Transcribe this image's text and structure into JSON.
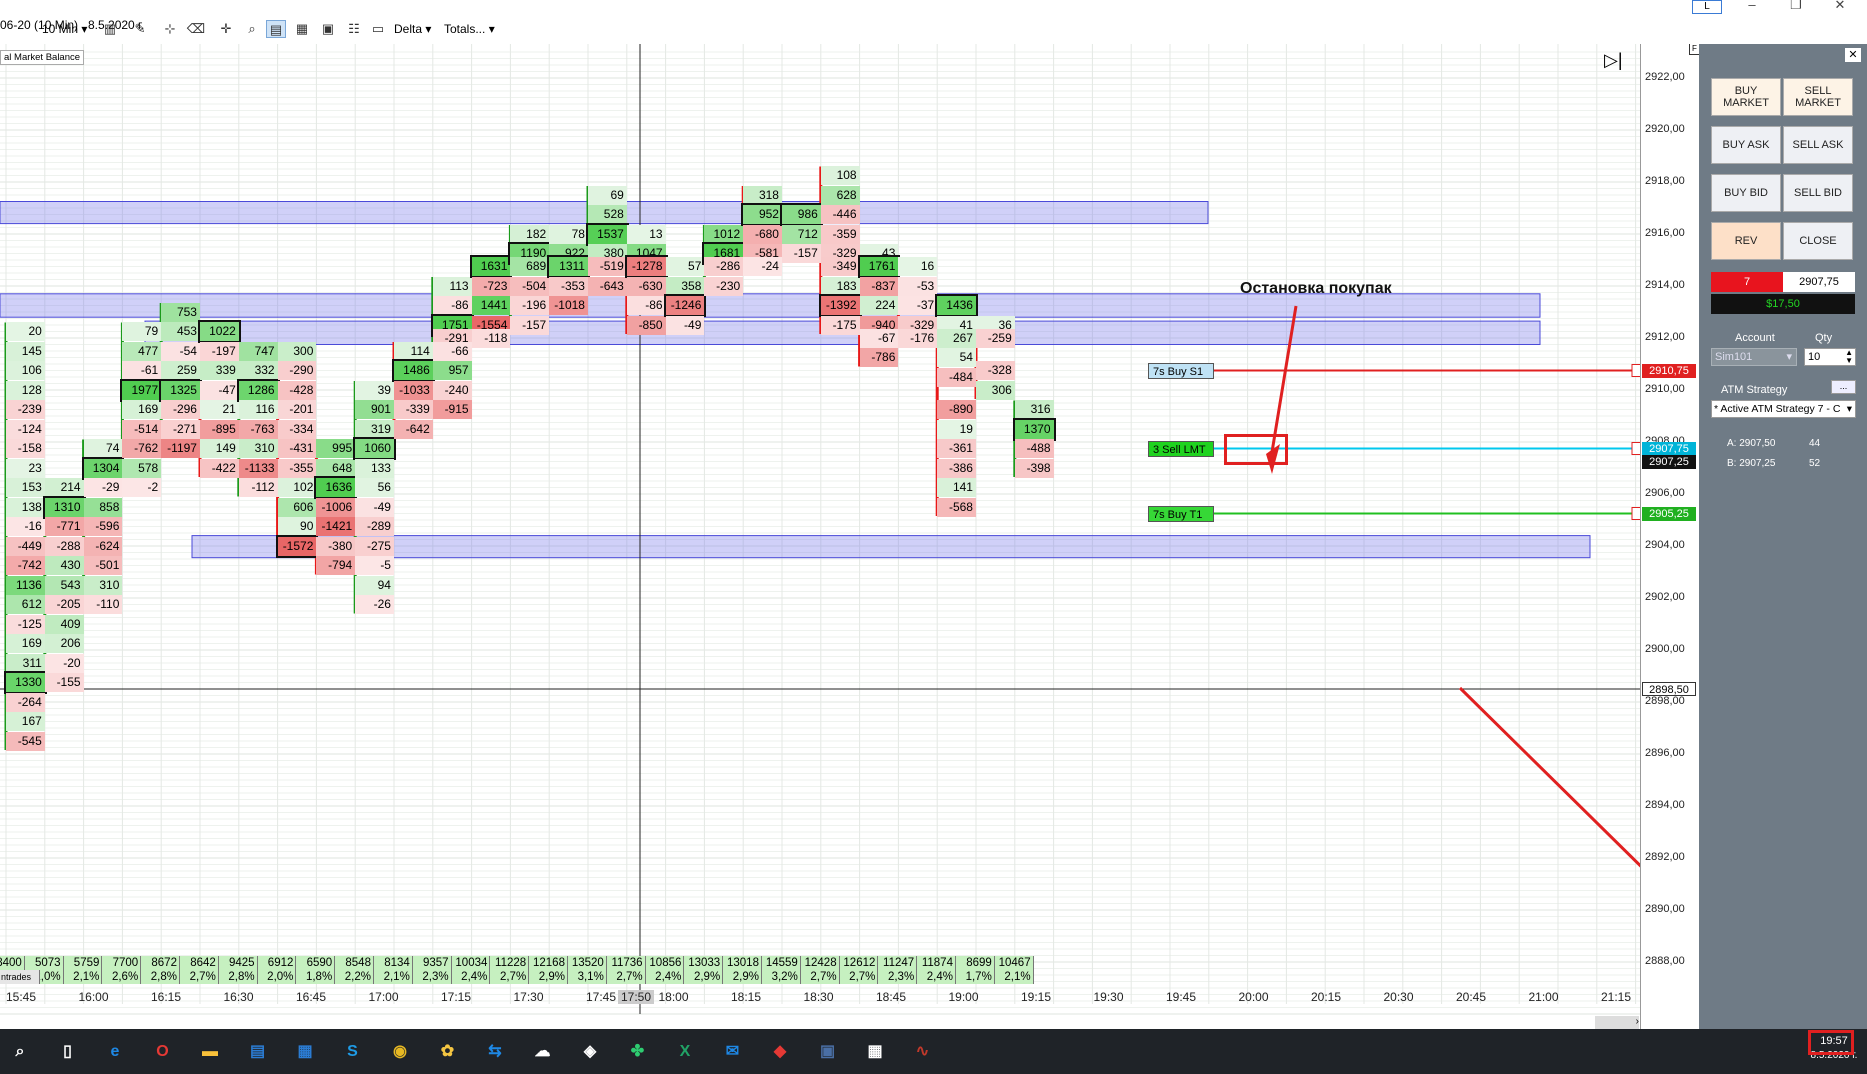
{
  "toolbar": {
    "instrument": "06-20 (10 Min)",
    "date": "8.5.2020 г.",
    "timeframe": "10 Min",
    "delta_label": "Delta",
    "totals_label": "Totals...",
    "right_badge": "L"
  },
  "chart": {
    "indicator_label": "al Market Balance",
    "annotation": "Остановка покупак",
    "crosshair_time": "17:50",
    "trades_label": "ntrades",
    "price_ticks": [
      {
        "label": "2922,00",
        "price": 2922
      },
      {
        "label": "2920,00",
        "price": 2920
      },
      {
        "label": "2918,00",
        "price": 2918
      },
      {
        "label": "2916,00",
        "price": 2916
      },
      {
        "label": "2914,00",
        "price": 2914
      },
      {
        "label": "2912,00",
        "price": 2912
      },
      {
        "label": "2910,00",
        "price": 2910
      },
      {
        "label": "2908,00",
        "price": 2908
      },
      {
        "label": "2906,00",
        "price": 2906
      },
      {
        "label": "2904,00",
        "price": 2904
      },
      {
        "label": "2902,00",
        "price": 2902
      },
      {
        "label": "2900,00",
        "price": 2900
      },
      {
        "label": "2898,00",
        "price": 2898
      },
      {
        "label": "2896,00",
        "price": 2896
      },
      {
        "label": "2894,00",
        "price": 2894
      },
      {
        "label": "2892,00",
        "price": 2892
      },
      {
        "label": "2890,00",
        "price": 2890
      },
      {
        "label": "2888,00",
        "price": 2888
      }
    ],
    "price_tags": [
      {
        "label": "2910,75",
        "price": 2910.75,
        "color": "#e02020"
      },
      {
        "label": "2907,75",
        "price": 2907.75,
        "color": "#00b4d8"
      },
      {
        "label": "2907,25",
        "price": 2907.25,
        "color": "#111111"
      },
      {
        "label": "2905,25",
        "price": 2905.25,
        "color": "#20b020"
      },
      {
        "label": "2898,50",
        "price": 2898.5,
        "color": "#ffffff"
      }
    ],
    "time_labels": [
      "15:45",
      "16:00",
      "16:15",
      "16:30",
      "16:45",
      "17:00",
      "17:15",
      "17:30",
      "17:45",
      "18:00",
      "18:15",
      "18:30",
      "18:45",
      "19:00",
      "19:15",
      "19:30",
      "19:45",
      "20:00",
      "20:15",
      "20:30",
      "20:45",
      "21:00",
      "21:15"
    ],
    "volumes": [
      "8400",
      "5073",
      "5759",
      "7700",
      "8672",
      "8642",
      "9425",
      "6912",
      "6590",
      "8548",
      "8134",
      "9357",
      "10034",
      "11228",
      "12168",
      "13520",
      "11736",
      "10856",
      "13033",
      "13018",
      "14559",
      "12428",
      "12612",
      "11247",
      "11874",
      "8699",
      "10467"
    ],
    "deltas": [
      "",
      "2,0%",
      "2,1%",
      "2,6%",
      "2,8%",
      "2,7%",
      "2,8%",
      "2,0%",
      "1,8%",
      "2,2%",
      "2,1%",
      "2,3%",
      "2,4%",
      "2,7%",
      "2,9%",
      "3,1%",
      "2,7%",
      "2,4%",
      "2,9%",
      "2,9%",
      "3,2%",
      "2,7%",
      "2,7%",
      "2,3%",
      "2,4%",
      "1,7%",
      "2,1%"
    ],
    "orders": [
      {
        "label": "7s  Buy S1",
        "price": 2910.75
      },
      {
        "label": "3  Sell LMT",
        "price": 2907.75
      },
      {
        "label": "7s  Buy T1",
        "price": 2905.25
      }
    ],
    "bars": [
      {
        "cells": [
          [
            2912.25,
            "20"
          ],
          [
            2911.5,
            "145"
          ],
          [
            2910.75,
            "106"
          ],
          [
            2910,
            "128"
          ],
          [
            2909.25,
            "-239"
          ],
          [
            2908.5,
            "-124"
          ],
          [
            2907.75,
            "-158"
          ],
          [
            2907,
            "23"
          ],
          [
            2906.25,
            "153"
          ],
          [
            2905.5,
            "138"
          ],
          [
            2904.75,
            "-16"
          ],
          [
            2904,
            "-449"
          ],
          [
            2903.25,
            "-742"
          ],
          [
            2902.5,
            "1136"
          ],
          [
            2901.75,
            "612"
          ],
          [
            2901,
            "-125"
          ],
          [
            2900.25,
            "169"
          ],
          [
            2899.5,
            "311"
          ],
          [
            2898.75,
            "1330"
          ],
          [
            2898,
            "-264"
          ],
          [
            2897.25,
            "167"
          ],
          [
            2896.5,
            "-545"
          ]
        ]
      },
      {
        "cells": [
          [
            2906.25,
            "214"
          ],
          [
            2905.5,
            "1310"
          ],
          [
            2904.75,
            "-771"
          ],
          [
            2904,
            "-288"
          ],
          [
            2903.25,
            "430"
          ],
          [
            2902.5,
            "543"
          ],
          [
            2901.75,
            "-205"
          ],
          [
            2901,
            "409"
          ],
          [
            2900.25,
            "206"
          ],
          [
            2899.5,
            "-20"
          ],
          [
            2898.75,
            "-155"
          ]
        ]
      },
      {
        "cells": [
          [
            2907.75,
            "74"
          ],
          [
            2907,
            "1304"
          ],
          [
            2906.25,
            "-29"
          ],
          [
            2905.5,
            "858"
          ],
          [
            2904.75,
            "-596"
          ],
          [
            2904,
            "-624"
          ],
          [
            2903.25,
            "-501"
          ],
          [
            2902.5,
            "310"
          ],
          [
            2901.75,
            "-110"
          ]
        ]
      },
      {
        "cells": [
          [
            2912.25,
            "79"
          ],
          [
            2911.5,
            "477"
          ],
          [
            2910.75,
            "-61"
          ],
          [
            2910,
            "1977"
          ],
          [
            2909.25,
            "169"
          ],
          [
            2908.5,
            "-514"
          ],
          [
            2907.75,
            "-762"
          ],
          [
            2907,
            "578"
          ],
          [
            2906.25,
            "-2"
          ]
        ]
      },
      {
        "cells": [
          [
            2913,
            "753"
          ],
          [
            2912.25,
            "453"
          ],
          [
            2911.5,
            "-54"
          ],
          [
            2910.75,
            "259"
          ],
          [
            2910,
            "1325"
          ],
          [
            2909.25,
            "-296"
          ],
          [
            2908.5,
            "-271"
          ],
          [
            2907.75,
            "-1197"
          ]
        ]
      },
      {
        "cells": [
          [
            2912.25,
            "1022"
          ],
          [
            2911.5,
            "-197"
          ],
          [
            2910.75,
            "339"
          ],
          [
            2910,
            "-47"
          ],
          [
            2909.25,
            "21"
          ],
          [
            2908.5,
            "-895"
          ],
          [
            2907.75,
            "149"
          ],
          [
            2907,
            "-422"
          ]
        ]
      },
      {
        "cells": [
          [
            2911.5,
            "747"
          ],
          [
            2910.75,
            "332"
          ],
          [
            2910,
            "1286"
          ],
          [
            2909.25,
            "116"
          ],
          [
            2908.5,
            "-763"
          ],
          [
            2907.75,
            "310"
          ],
          [
            2907,
            "-1133"
          ],
          [
            2906.25,
            "-112"
          ]
        ]
      },
      {
        "cells": [
          [
            2911.5,
            "300"
          ],
          [
            2910.75,
            "-290"
          ],
          [
            2910,
            "-428"
          ],
          [
            2909.25,
            "-201"
          ],
          [
            2908.5,
            "-334"
          ],
          [
            2907.75,
            "-431"
          ],
          [
            2907,
            "-355"
          ],
          [
            2906.25,
            "102"
          ],
          [
            2905.5,
            "606"
          ],
          [
            2904.75,
            "90"
          ],
          [
            2904,
            "-1572"
          ]
        ]
      },
      {
        "cells": [
          [
            2907.75,
            "995"
          ],
          [
            2907,
            "648"
          ],
          [
            2906.25,
            "1636"
          ],
          [
            2905.5,
            "-1006"
          ],
          [
            2904.75,
            "-1421"
          ],
          [
            2904,
            "-380"
          ],
          [
            2903.25,
            "-794"
          ]
        ]
      },
      {
        "cells": [
          [
            2910,
            "39"
          ],
          [
            2909.25,
            "901"
          ],
          [
            2908.5,
            "319"
          ],
          [
            2907.75,
            "1060"
          ],
          [
            2907,
            "133"
          ],
          [
            2906.25,
            "56"
          ],
          [
            2905.5,
            "-49"
          ],
          [
            2904.75,
            "-289"
          ],
          [
            2904,
            "-275"
          ],
          [
            2903.25,
            "-5"
          ],
          [
            2902.5,
            "94"
          ],
          [
            2901.75,
            "-26"
          ]
        ]
      },
      {
        "cells": [
          [
            2911.5,
            "114"
          ],
          [
            2910.75,
            "1486"
          ],
          [
            2910,
            "-1033"
          ],
          [
            2909.25,
            "-339"
          ],
          [
            2908.5,
            "-642"
          ]
        ]
      },
      {
        "cells": [
          [
            2914,
            "113"
          ],
          [
            2913.25,
            "-86"
          ],
          [
            2912.5,
            "1751"
          ],
          [
            2912,
            "-291"
          ],
          [
            2911.5,
            "-66"
          ],
          [
            2910.75,
            "957"
          ],
          [
            2910,
            "-240"
          ],
          [
            2909.25,
            "-915"
          ]
        ]
      },
      {
        "cells": [
          [
            2914.75,
            "1631"
          ],
          [
            2914,
            "-723"
          ],
          [
            2913.25,
            "1441"
          ],
          [
            2912.5,
            "-1554"
          ],
          [
            2912,
            "-118"
          ]
        ]
      },
      {
        "cells": [
          [
            2916,
            "182"
          ],
          [
            2915.25,
            "1190"
          ],
          [
            2914.75,
            "689"
          ],
          [
            2914,
            "-504"
          ],
          [
            2913.25,
            "-196"
          ],
          [
            2912.5,
            "-157"
          ]
        ]
      },
      {
        "cells": [
          [
            2916,
            "78"
          ],
          [
            2915.25,
            "922"
          ],
          [
            2914.75,
            "1311"
          ],
          [
            2914,
            "-353"
          ],
          [
            2913.25,
            "-1018"
          ]
        ]
      },
      {
        "cells": [
          [
            2917.5,
            "69"
          ],
          [
            2916.75,
            "528"
          ],
          [
            2916,
            "1537"
          ],
          [
            2915.25,
            "380"
          ],
          [
            2914.75,
            "-519"
          ],
          [
            2914,
            "-643"
          ]
        ]
      },
      {
        "cells": [
          [
            2916,
            "13"
          ],
          [
            2915.25,
            "1047"
          ],
          [
            2914.75,
            "-1278"
          ],
          [
            2914,
            "-630"
          ],
          [
            2913.25,
            "-86"
          ],
          [
            2912.5,
            "-850"
          ]
        ]
      },
      {
        "cells": [
          [
            2914.75,
            "57"
          ],
          [
            2914,
            "358"
          ],
          [
            2913.25,
            "-1246"
          ],
          [
            2912.5,
            "-49"
          ]
        ]
      },
      {
        "cells": [
          [
            2916,
            "1012"
          ],
          [
            2915.25,
            "1681"
          ],
          [
            2914.75,
            "-286"
          ],
          [
            2914,
            "-230"
          ]
        ]
      },
      {
        "cells": [
          [
            2917.5,
            "318"
          ],
          [
            2916.75,
            "952"
          ],
          [
            2916,
            "-680"
          ],
          [
            2915.25,
            "-581"
          ],
          [
            2914.75,
            "-24"
          ]
        ]
      },
      {
        "cells": [
          [
            2916.75,
            "986"
          ],
          [
            2916,
            "712"
          ],
          [
            2915.25,
            "-157"
          ]
        ]
      },
      {
        "cells": [
          [
            2918.25,
            "108"
          ],
          [
            2917.5,
            "628"
          ],
          [
            2916.75,
            "-446"
          ],
          [
            2916,
            "-359"
          ],
          [
            2915.25,
            "-329"
          ],
          [
            2914.75,
            "-349"
          ],
          [
            2914,
            "183"
          ],
          [
            2913.25,
            "-1392"
          ],
          [
            2912.5,
            "-175"
          ]
        ]
      },
      {
        "cells": [
          [
            2915.25,
            "43"
          ],
          [
            2914.75,
            "1761"
          ],
          [
            2914,
            "-837"
          ],
          [
            2913.25,
            "224"
          ],
          [
            2912.5,
            "-940"
          ],
          [
            2912,
            "-67"
          ],
          [
            2911.25,
            "-786"
          ]
        ]
      },
      {
        "cells": [
          [
            2914.75,
            "16"
          ],
          [
            2914,
            "-53"
          ],
          [
            2913.25,
            "-37"
          ],
          [
            2912.5,
            "-329"
          ],
          [
            2912,
            "-176"
          ]
        ]
      },
      {
        "cells": [
          [
            2913.25,
            "1436"
          ],
          [
            2912.5,
            "41"
          ],
          [
            2912,
            "267"
          ],
          [
            2911.25,
            "54"
          ],
          [
            2910.5,
            "-484"
          ],
          [
            2909.25,
            "-890"
          ],
          [
            2908.5,
            "19"
          ],
          [
            2907.75,
            "-361"
          ],
          [
            2907,
            "-386"
          ],
          [
            2906.25,
            "141"
          ],
          [
            2905.5,
            "-568"
          ]
        ]
      },
      {
        "cells": [
          [
            2912.5,
            "36"
          ],
          [
            2912,
            "-259"
          ],
          [
            2910.75,
            "-328"
          ],
          [
            2910,
            "306"
          ]
        ]
      },
      {
        "cells": [
          [
            2909.25,
            "316"
          ],
          [
            2908.5,
            "1370"
          ],
          [
            2907.75,
            "-488"
          ],
          [
            2907,
            "-398"
          ]
        ]
      }
    ],
    "zones": [
      {
        "top": 2917.25,
        "bottom": 2916.4
      },
      {
        "top": 2913.7,
        "bottom": 2912.8
      },
      {
        "top": 2912.65,
        "bottom": 2911.75
      },
      {
        "top": 2904.4,
        "bottom": 2903.55
      }
    ]
  },
  "panel": {
    "buy_market": "BUY MARKET",
    "sell_market": "SELL MARKET",
    "buy_ask": "BUY ASK",
    "sell_ask": "SELL ASK",
    "buy_bid": "BUY BID",
    "sell_bid": "SELL BID",
    "rev": "REV",
    "close": "CLOSE",
    "position_qty": "7",
    "position_price": "2907,75",
    "pnl": "$17,50",
    "account_label": "Account",
    "qty_label": "Qty",
    "account_value": "Sim101",
    "qty_value": "10",
    "atm_label": "ATM Strategy",
    "atm_value": "* Active ATM Strategy 7 - C",
    "ask_label": "A: 2907,50",
    "ask_size": "44",
    "bid_label": "B: 2907,25",
    "bid_size": "52"
  },
  "taskbar": {
    "time": "19:57",
    "date": "8.5.2020 г.",
    "icons": [
      "search-icon",
      "task-view-icon",
      "edge-icon",
      "opera-icon",
      "folder-icon",
      "store-icon",
      "calendar-icon",
      "skype-icon",
      "chrome-icon",
      "paint-icon",
      "teamviewer-icon",
      "cloud-icon",
      "network-icon",
      "clover-icon",
      "excel-icon",
      "mail-icon",
      "anydesk-icon",
      "save-icon",
      "calculator-icon",
      "trading-icon"
    ]
  }
}
